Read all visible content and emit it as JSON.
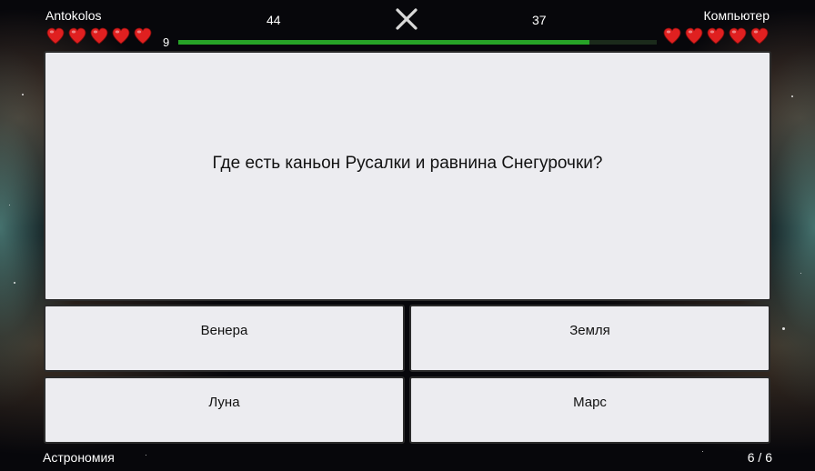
{
  "players": {
    "left": {
      "name": "Antokolos",
      "lives": 5,
      "score": "44"
    },
    "right": {
      "name": "Компьютер",
      "lives": 5,
      "score": "37"
    }
  },
  "timer": {
    "value": "9",
    "progress_fraction": 0.86
  },
  "question": "Где есть каньон Русалки и равнина Снегурочки?",
  "answers": [
    "Венера",
    "Земля",
    "Луна",
    "Марс"
  ],
  "footer": {
    "category": "Астрономия",
    "question_counter": "6 / 6"
  },
  "icons": {
    "close": "close-icon",
    "life": "heart-icon"
  },
  "colors": {
    "heart": "#e02020",
    "progress": "#27a327",
    "card": "#ececf0",
    "background": "#07070b"
  }
}
